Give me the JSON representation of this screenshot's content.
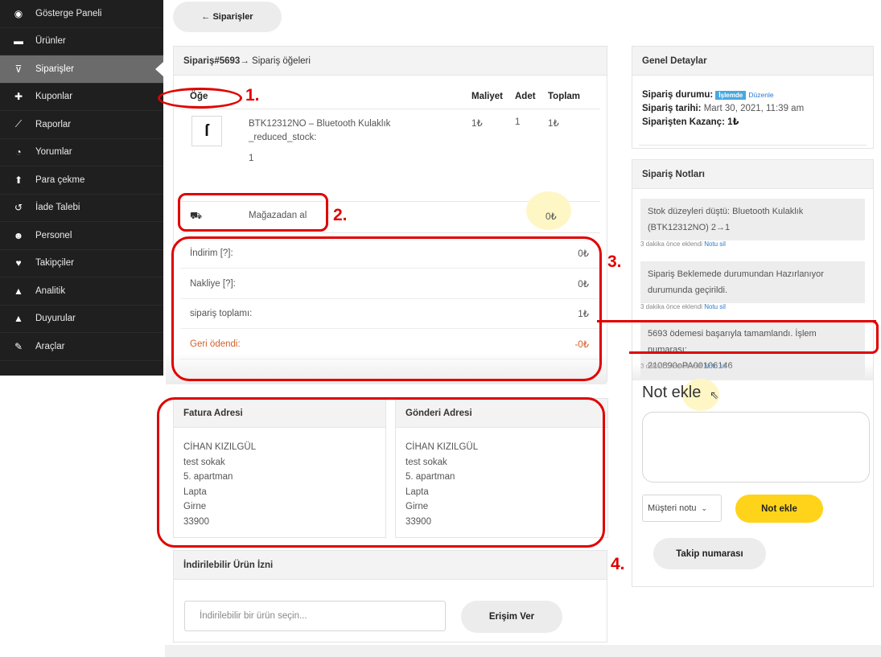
{
  "sidebar": {
    "items": [
      {
        "icon": "dashboard-icon",
        "glyph": "◉",
        "label": "Gösterge Paneli"
      },
      {
        "icon": "briefcase-icon",
        "glyph": "▬",
        "label": "Ürünler"
      },
      {
        "icon": "cart-icon",
        "glyph": "⊽",
        "label": "Siparişler",
        "active": true
      },
      {
        "icon": "gift-icon",
        "glyph": "✚",
        "label": "Kuponlar"
      },
      {
        "icon": "chart-icon",
        "glyph": "⟋",
        "label": "Raporlar"
      },
      {
        "icon": "comments-icon",
        "glyph": "◔",
        "label": "Yorumlar"
      },
      {
        "icon": "upload-icon",
        "glyph": "⬆",
        "label": "Para çekme"
      },
      {
        "icon": "undo-icon",
        "glyph": "↺",
        "label": "İade Talebi"
      },
      {
        "icon": "users-icon",
        "glyph": "☻",
        "label": "Personel"
      },
      {
        "icon": "heart-icon",
        "glyph": "♥",
        "label": "Takipçiler"
      },
      {
        "icon": "area-chart-icon",
        "glyph": "▲",
        "label": "Analitik"
      },
      {
        "icon": "bell-icon",
        "glyph": "▲",
        "label": "Duyurular"
      },
      {
        "icon": "wrench-icon",
        "glyph": "✎",
        "label": "Araçlar"
      }
    ]
  },
  "back_button": {
    "label": "← Siparişler"
  },
  "order_items": {
    "title_bold": "Sipariş#5693",
    "title_rest": " → Sipariş öğeleri",
    "headers": {
      "item": "Öğe",
      "cost": "Maliyet",
      "qty": "Adet",
      "total": "Toplam"
    },
    "product": {
      "name_line1": "BTK12312NO – Bluetooth Kulaklık",
      "name_line2": "_reduced_stock:",
      "meta": "1",
      "cost": "1₺",
      "qty": "1",
      "total": "1₺"
    },
    "shipping": {
      "label": "Mağazadan al",
      "amount": "0₺"
    },
    "totals": [
      {
        "label": "İndirim [?]:",
        "value": "0₺"
      },
      {
        "label": "Nakliye [?]:",
        "value": "0₺"
      },
      {
        "label": "sipariş toplamı:",
        "value": "1₺"
      },
      {
        "label": "Geri ödendi:",
        "value": "-0₺"
      }
    ]
  },
  "general_details": {
    "title": "Genel Detaylar",
    "status_label": "Sipariş durumu:",
    "status_badge": "İşlemde",
    "edit_link": "Düzenle",
    "date_label": "Sipariş tarihi:",
    "date_value": "Mart 30, 2021, 11:39 am",
    "earning_label": "Siparişten Kazanç: 1₺"
  },
  "order_notes": {
    "title": "Sipariş Notları",
    "notes": [
      {
        "line1": "Stok düzeyleri düştü: Bluetooth Kulaklık",
        "line2": "(BTK12312NO) 2→1",
        "meta": "3 dakika önce eklendi",
        "delete": "Notu sil"
      },
      {
        "line1": "Sipariş Beklemede durumundan Hazırlanıyor",
        "line2": "durumunda geçirildi.",
        "meta": "3 dakika önce eklendi",
        "delete": "Notu sil"
      },
      {
        "line1": "5693 ödemesi başarıyla tamamlandı. İşlem numarası:",
        "line2": "210890oPA00106146",
        "meta": "3 dakika önce eklendi",
        "delete": "Notu sil"
      }
    ],
    "add_title": "Not ekle",
    "note_type_value": "Müşteri notu",
    "add_button": "Not ekle",
    "tracking_button": "Takip numarası"
  },
  "billing": {
    "title": "Fatura Adresi",
    "lines": [
      "CİHAN KIZILGÜL",
      "test sokak",
      "5. apartman",
      "Lapta",
      "Girne",
      "33900"
    ]
  },
  "shipping_address": {
    "title": "Gönderi Adresi",
    "lines": [
      "CİHAN KIZILGÜL",
      "test sokak",
      "5. apartman",
      "Lapta",
      "Girne",
      "33900"
    ]
  },
  "downloadable": {
    "title": "İndirilebilir Ürün İzni",
    "placeholder": "İndirilebilir bir ürün seçin...",
    "button": "Erişim Ver"
  },
  "annotations": {
    "n1": "1.",
    "n2": "2.",
    "n3": "3.",
    "n4": "4."
  },
  "colors": {
    "accent_yellow": "#ffd31a",
    "annotation_red": "#e00000",
    "badge_blue": "#48a8e0",
    "refund_orange": "#d0622a"
  }
}
